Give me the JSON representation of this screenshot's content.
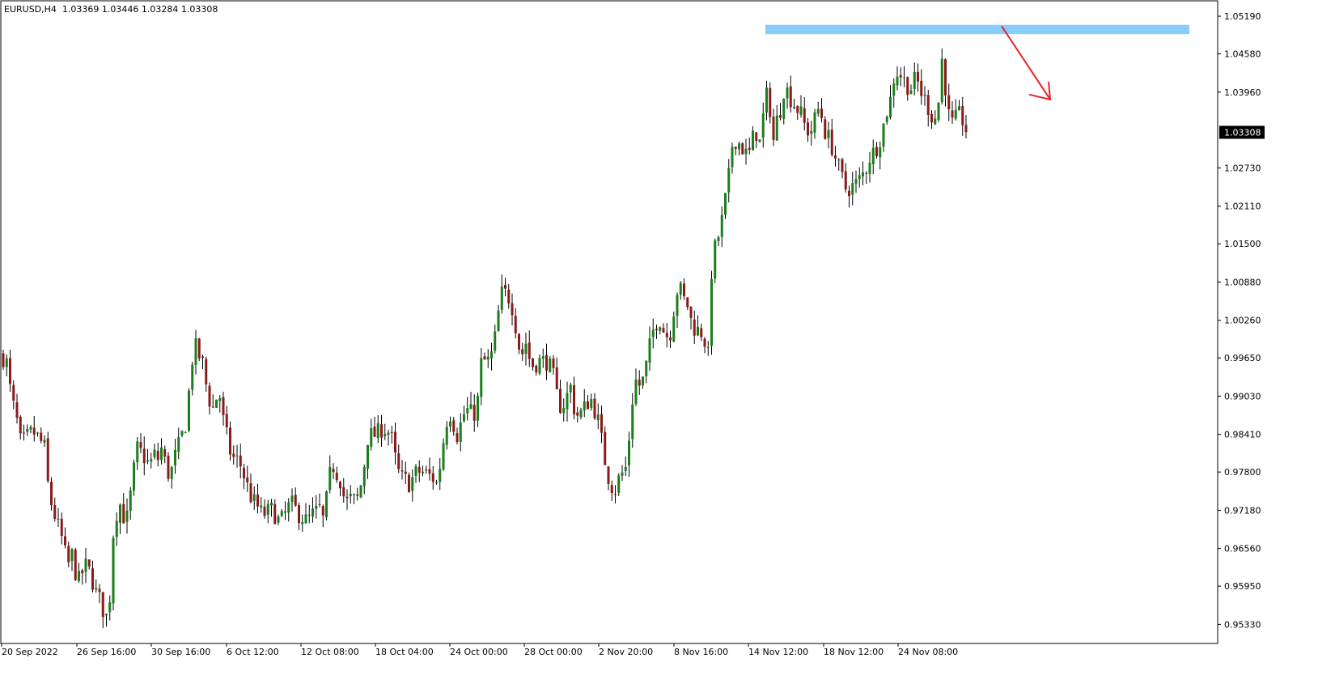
{
  "header": {
    "symbol": "EURUSD,H4",
    "ohlc": "1.03369 1.03446 1.03284 1.03308"
  },
  "colors": {
    "bull": "#1a7f1a",
    "bear": "#8b1a1a",
    "wick": "#000000",
    "zone": "#87cefa",
    "arrow": "#e8202a",
    "price_box": "#000000",
    "price_text": "#ffffff",
    "axis": "#000000"
  },
  "chart_data": {
    "type": "candlestick",
    "symbol": "EURUSD",
    "timeframe": "H4",
    "ylim": [
      0.9502,
      1.0544
    ],
    "y_ticks": [
      "1.05190",
      "1.04580",
      "1.03960",
      "1.03308",
      "1.02730",
      "1.02110",
      "1.01500",
      "1.00880",
      "1.00260",
      "0.99650",
      "0.99030",
      "0.98410",
      "0.97800",
      "0.97180",
      "0.96560",
      "0.95950",
      "0.95330"
    ],
    "x_ticks": [
      "20 Sep 2022",
      "26 Sep 16:00",
      "30 Sep 16:00",
      "6 Oct 12:00",
      "12 Oct 08:00",
      "18 Oct 04:00",
      "24 Oct 00:00",
      "28 Oct 00:00",
      "2 Nov 20:00",
      "8 Nov 16:00",
      "14 Nov 12:00",
      "18 Nov 12:00",
      "24 Nov 08:00"
    ],
    "current_price": "1.03308",
    "resistance_zone": [
      1.049,
      1.0505
    ],
    "arrow_direction": "down",
    "close_path": [
      [
        0,
        0.997
      ],
      [
        8,
        0.996
      ],
      [
        14,
        0.99
      ],
      [
        20,
        0.987
      ],
      [
        25,
        0.983
      ],
      [
        30,
        0.983
      ],
      [
        35,
        0.984
      ],
      [
        40,
        0.9845
      ],
      [
        45,
        0.984
      ],
      [
        50,
        0.983
      ],
      [
        55,
        0.982
      ],
      [
        60,
        0.975
      ],
      [
        65,
        0.972
      ],
      [
        70,
        0.97
      ],
      [
        75,
        0.968
      ],
      [
        80,
        0.965
      ],
      [
        85,
        0.963
      ],
      [
        90,
        0.965
      ],
      [
        95,
        0.96
      ],
      [
        100,
        0.961
      ],
      [
        105,
        0.963
      ],
      [
        110,
        0.962
      ],
      [
        115,
        0.96
      ],
      [
        120,
        0.958
      ],
      [
        125,
        0.957
      ],
      [
        130,
        0.954
      ],
      [
        135,
        0.956
      ],
      [
        140,
        0.968
      ],
      [
        145,
        0.972
      ],
      [
        150,
        0.973
      ],
      [
        155,
        0.969
      ],
      [
        160,
        0.973
      ],
      [
        165,
        0.978
      ],
      [
        170,
        0.982
      ],
      [
        175,
        0.981
      ],
      [
        180,
        0.98
      ],
      [
        185,
        0.979
      ],
      [
        190,
        0.981
      ],
      [
        195,
        0.98
      ],
      [
        200,
        0.982
      ],
      [
        205,
        0.979
      ],
      [
        210,
        0.977
      ],
      [
        215,
        0.98
      ],
      [
        220,
        0.982
      ],
      [
        225,
        0.984
      ],
      [
        230,
        0.986
      ],
      [
        235,
        0.993
      ],
      [
        240,
        0.999
      ],
      [
        245,
        0.997
      ],
      [
        250,
        0.996
      ],
      [
        255,
        0.992
      ],
      [
        260,
        0.989
      ],
      [
        265,
        0.988
      ],
      [
        270,
        0.992
      ],
      [
        275,
        0.987
      ],
      [
        280,
        0.984
      ],
      [
        285,
        0.981
      ],
      [
        290,
        0.98
      ],
      [
        295,
        0.98
      ],
      [
        300,
        0.978
      ],
      [
        305,
        0.976
      ],
      [
        310,
        0.974
      ],
      [
        315,
        0.973
      ],
      [
        320,
        0.972
      ],
      [
        325,
        0.971
      ],
      [
        330,
        0.9715
      ],
      [
        335,
        0.972
      ],
      [
        340,
        0.971
      ],
      [
        345,
        0.97
      ],
      [
        350,
        0.9705
      ],
      [
        355,
        0.972
      ],
      [
        360,
        0.973
      ],
      [
        365,
        0.972
      ],
      [
        370,
        0.971
      ],
      [
        375,
        0.9705
      ],
      [
        380,
        0.97
      ],
      [
        385,
        0.971
      ],
      [
        390,
        0.9715
      ],
      [
        395,
        0.972
      ],
      [
        400,
        0.97
      ],
      [
        405,
        0.975
      ],
      [
        410,
        0.9795
      ],
      [
        415,
        0.978
      ],
      [
        420,
        0.977
      ],
      [
        425,
        0.974
      ],
      [
        430,
        0.973
      ],
      [
        435,
        0.974
      ],
      [
        440,
        0.973
      ],
      [
        445,
        0.975
      ],
      [
        450,
        0.979
      ],
      [
        455,
        0.984
      ],
      [
        460,
        0.984
      ],
      [
        465,
        0.984
      ],
      [
        470,
        0.985
      ],
      [
        475,
        0.985
      ],
      [
        480,
        0.9845
      ],
      [
        485,
        0.983
      ],
      [
        490,
        0.979
      ],
      [
        495,
        0.977
      ],
      [
        500,
        0.977
      ],
      [
        505,
        0.976
      ],
      [
        510,
        0.977
      ],
      [
        515,
        0.978
      ],
      [
        520,
        0.978
      ],
      [
        525,
        0.978
      ],
      [
        530,
        0.9775
      ],
      [
        535,
        0.977
      ],
      [
        540,
        0.976
      ],
      [
        545,
        0.98
      ],
      [
        550,
        0.985
      ],
      [
        555,
        0.988
      ],
      [
        560,
        0.986
      ],
      [
        565,
        0.984
      ],
      [
        570,
        0.986
      ],
      [
        575,
        0.988
      ],
      [
        580,
        0.988
      ],
      [
        585,
        0.987
      ],
      [
        590,
        0.989
      ],
      [
        595,
        0.996
      ],
      [
        600,
        0.996
      ],
      [
        605,
        0.996
      ],
      [
        610,
        0.998
      ],
      [
        615,
        1.003
      ],
      [
        620,
        1.007
      ],
      [
        625,
        1.007
      ],
      [
        630,
        1.006
      ],
      [
        635,
        1.004
      ],
      [
        640,
        0.999
      ],
      [
        645,
        0.997
      ],
      [
        650,
        0.999
      ],
      [
        655,
        0.996
      ],
      [
        660,
        0.995
      ],
      [
        665,
        0.996
      ],
      [
        670,
        0.996
      ],
      [
        675,
        0.996
      ],
      [
        680,
        0.995
      ],
      [
        685,
        0.993
      ],
      [
        690,
        0.989
      ],
      [
        695,
        0.9885
      ],
      [
        700,
        0.99
      ],
      [
        705,
        0.992
      ],
      [
        710,
        0.988
      ],
      [
        715,
        0.987
      ],
      [
        720,
        0.988
      ],
      [
        725,
        0.989
      ],
      [
        730,
        0.99
      ],
      [
        735,
        0.988
      ],
      [
        740,
        0.986
      ],
      [
        745,
        0.982
      ],
      [
        750,
        0.978
      ],
      [
        755,
        0.976
      ],
      [
        760,
        0.975
      ],
      [
        765,
        0.977
      ],
      [
        770,
        0.978
      ],
      [
        775,
        0.979
      ],
      [
        780,
        0.988
      ],
      [
        785,
        0.993
      ],
      [
        790,
        0.992
      ],
      [
        795,
        0.993
      ],
      [
        800,
        0.996
      ],
      [
        805,
        1.0
      ],
      [
        810,
        1.002
      ],
      [
        815,
        1.003
      ],
      [
        820,
        1.001
      ],
      [
        825,
        1.0
      ],
      [
        830,
        1.001
      ],
      [
        835,
        1.007
      ],
      [
        840,
        1.008
      ],
      [
        845,
        1.006
      ],
      [
        850,
        1.005
      ],
      [
        855,
        1.002
      ],
      [
        860,
        1.001
      ],
      [
        865,
        1.001
      ],
      [
        870,
        1.0
      ],
      [
        875,
        0.996
      ],
      [
        880,
        1.012
      ],
      [
        885,
        1.015
      ],
      [
        890,
        1.017
      ],
      [
        895,
        1.021
      ],
      [
        900,
        1.025
      ],
      [
        905,
        1.031
      ],
      [
        910,
        1.032
      ],
      [
        915,
        1.031
      ],
      [
        920,
        1.03
      ],
      [
        925,
        1.029
      ],
      [
        930,
        1.032
      ],
      [
        935,
        1.033
      ],
      [
        940,
        1.031
      ],
      [
        945,
        1.038
      ],
      [
        950,
        1.04
      ],
      [
        955,
        1.031
      ],
      [
        960,
        1.035
      ],
      [
        965,
        1.037
      ],
      [
        970,
        1.041
      ],
      [
        975,
        1.039
      ],
      [
        980,
        1.038
      ],
      [
        985,
        1.037
      ],
      [
        990,
        1.036
      ],
      [
        995,
        1.034
      ],
      [
        1000,
        1.033
      ],
      [
        1005,
        1.034
      ],
      [
        1010,
        1.037
      ],
      [
        1015,
        1.036
      ],
      [
        1020,
        1.033
      ],
      [
        1025,
        1.032
      ],
      [
        1030,
        1.03
      ],
      [
        1035,
        1.028
      ],
      [
        1040,
        1.026
      ],
      [
        1045,
        1.024
      ],
      [
        1050,
        1.024
      ],
      [
        1055,
        1.0245
      ],
      [
        1060,
        1.025
      ],
      [
        1065,
        1.026
      ],
      [
        1070,
        1.027
      ],
      [
        1075,
        1.029
      ],
      [
        1080,
        1.03
      ],
      [
        1085,
        1.031
      ],
      [
        1090,
        1.033
      ],
      [
        1095,
        1.036
      ],
      [
        1100,
        1.038
      ],
      [
        1105,
        1.042
      ],
      [
        1110,
        1.043
      ],
      [
        1115,
        1.042
      ],
      [
        1120,
        1.041
      ],
      [
        1125,
        1.04
      ],
      [
        1130,
        1.0415
      ],
      [
        1135,
        1.041
      ],
      [
        1140,
        1.039
      ],
      [
        1145,
        1.038
      ],
      [
        1150,
        1.036
      ],
      [
        1155,
        1.035
      ],
      [
        1160,
        1.038
      ],
      [
        1165,
        1.046
      ],
      [
        1170,
        1.038
      ],
      [
        1175,
        1.034
      ],
      [
        1180,
        1.035
      ],
      [
        1185,
        1.036
      ],
      [
        1190,
        1.035
      ],
      [
        1195,
        1.0331
      ]
    ]
  }
}
